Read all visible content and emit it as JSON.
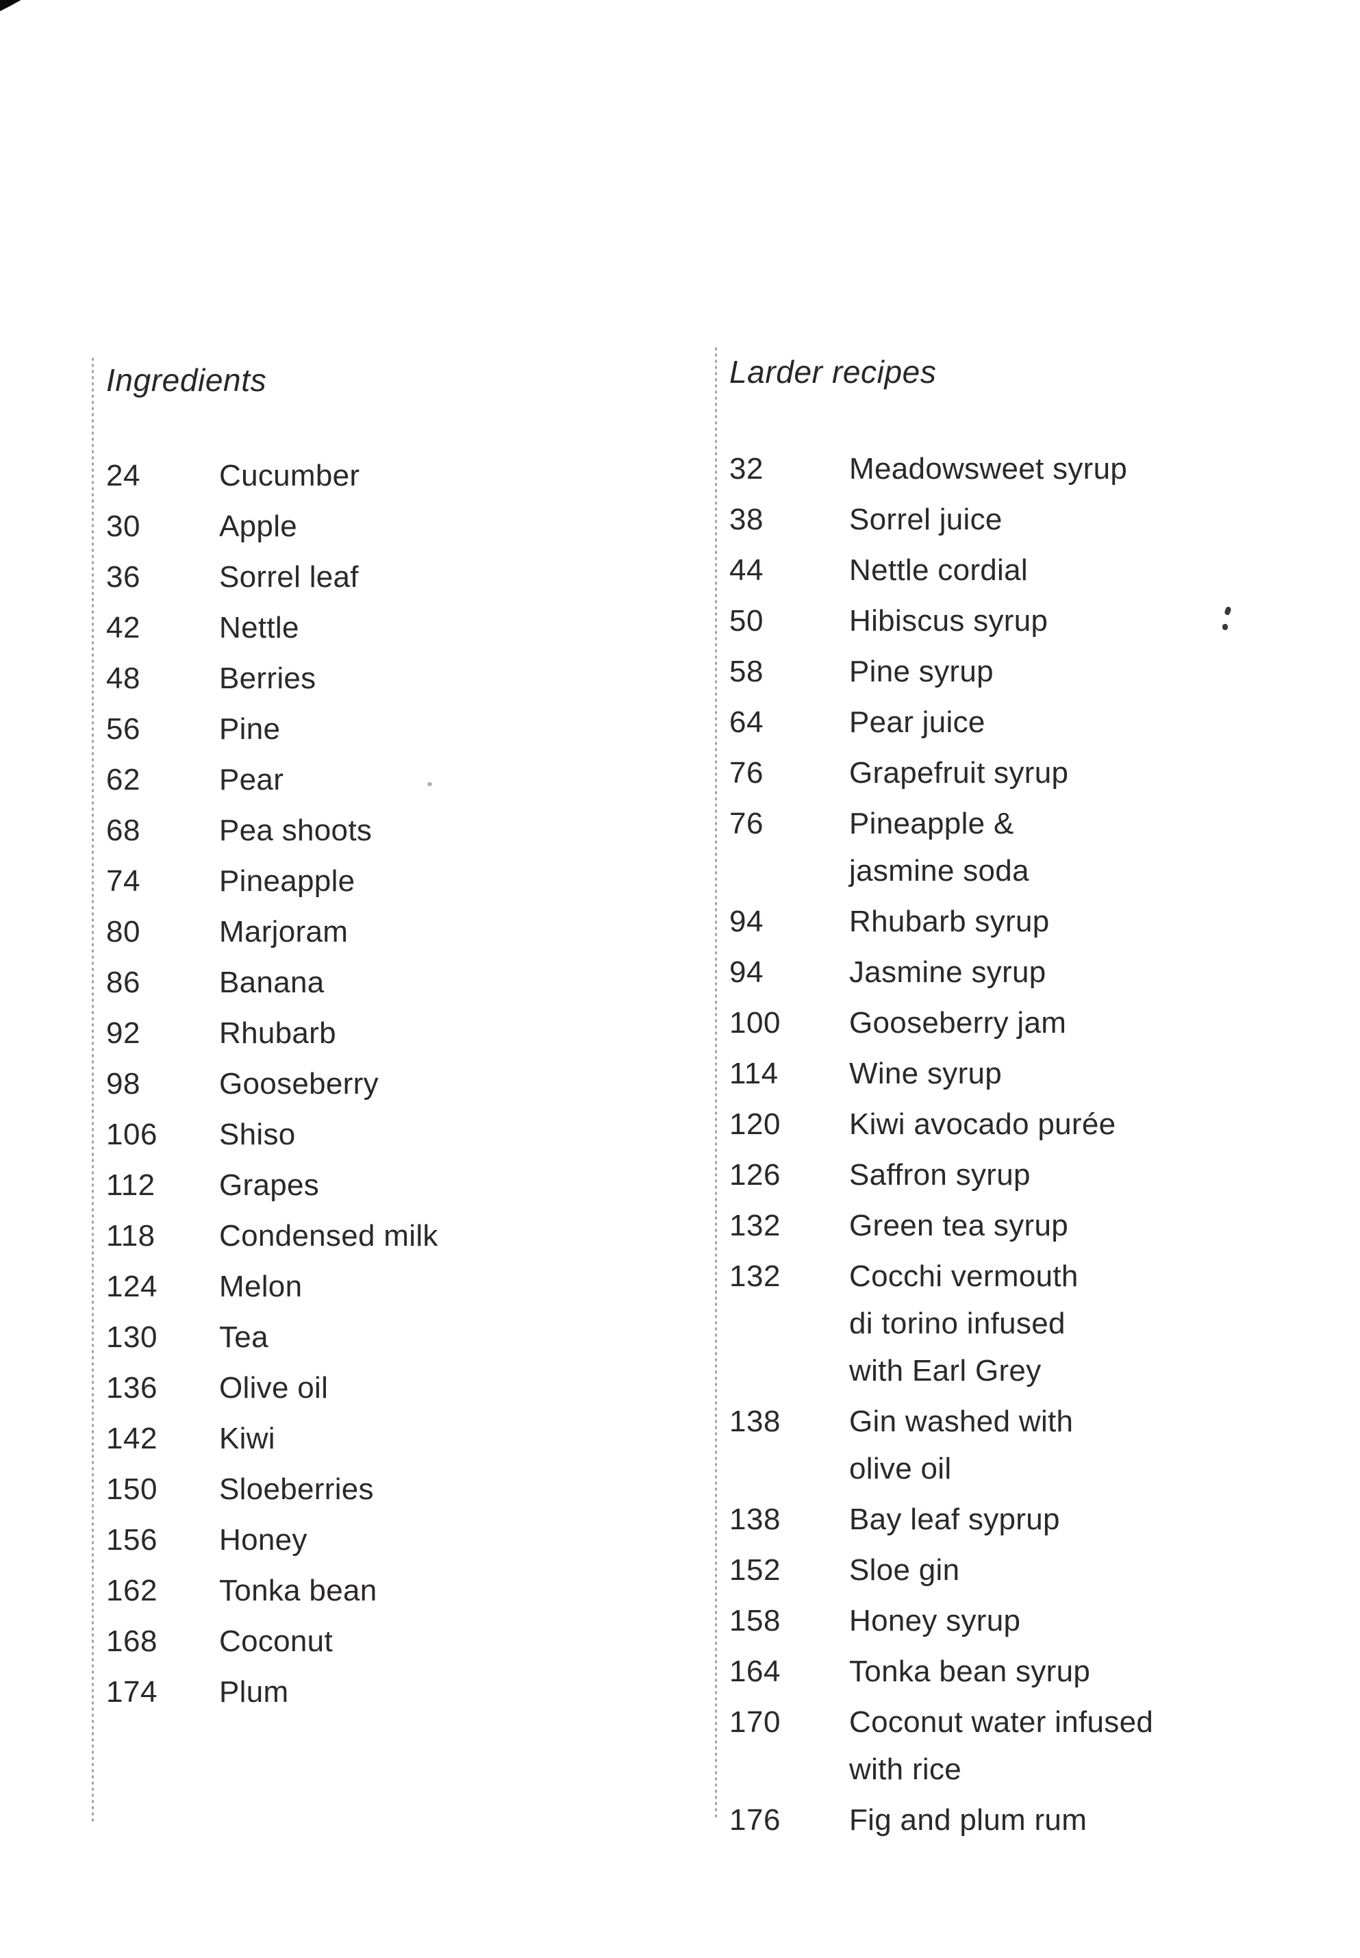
{
  "page": {
    "background_color": "#ffffff",
    "text_color": "#2c2829"
  },
  "columns": [
    {
      "id": "ingredients",
      "heading": "Ingredients",
      "entries": [
        {
          "page": "24",
          "lines": [
            "Cucumber"
          ]
        },
        {
          "page": "30",
          "lines": [
            "Apple"
          ]
        },
        {
          "page": "36",
          "lines": [
            "Sorrel leaf"
          ]
        },
        {
          "page": "42",
          "lines": [
            "Nettle"
          ]
        },
        {
          "page": "48",
          "lines": [
            "Berries"
          ]
        },
        {
          "page": "56",
          "lines": [
            "Pine"
          ]
        },
        {
          "page": "62",
          "lines": [
            "Pear"
          ]
        },
        {
          "page": "68",
          "lines": [
            "Pea shoots"
          ]
        },
        {
          "page": "74",
          "lines": [
            "Pineapple"
          ]
        },
        {
          "page": "80",
          "lines": [
            "Marjoram"
          ]
        },
        {
          "page": "86",
          "lines": [
            "Banana"
          ]
        },
        {
          "page": "92",
          "lines": [
            "Rhubarb"
          ]
        },
        {
          "page": "98",
          "lines": [
            "Gooseberry"
          ]
        },
        {
          "page": "106",
          "lines": [
            "Shiso"
          ]
        },
        {
          "page": "112",
          "lines": [
            "Grapes"
          ]
        },
        {
          "page": "118",
          "lines": [
            "Condensed milk"
          ]
        },
        {
          "page": "124",
          "lines": [
            "Melon"
          ]
        },
        {
          "page": "130",
          "lines": [
            "Tea"
          ]
        },
        {
          "page": "136",
          "lines": [
            "Olive oil"
          ]
        },
        {
          "page": "142",
          "lines": [
            "Kiwi"
          ]
        },
        {
          "page": "150",
          "lines": [
            "Sloeberries"
          ]
        },
        {
          "page": "156",
          "lines": [
            "Honey"
          ]
        },
        {
          "page": "162",
          "lines": [
            "Tonka bean"
          ]
        },
        {
          "page": "168",
          "lines": [
            "Coconut"
          ]
        },
        {
          "page": "174",
          "lines": [
            "Plum"
          ]
        }
      ]
    },
    {
      "id": "larder-recipes",
      "heading": "Larder recipes",
      "entries": [
        {
          "page": "32",
          "lines": [
            "Meadowsweet syrup"
          ]
        },
        {
          "page": "38",
          "lines": [
            "Sorrel juice"
          ]
        },
        {
          "page": "44",
          "lines": [
            "Nettle cordial"
          ]
        },
        {
          "page": "50",
          "lines": [
            "Hibiscus syrup"
          ]
        },
        {
          "page": "58",
          "lines": [
            "Pine syrup"
          ]
        },
        {
          "page": "64",
          "lines": [
            "Pear juice"
          ]
        },
        {
          "page": "76",
          "lines": [
            "Grapefruit syrup"
          ]
        },
        {
          "page": "76",
          "lines": [
            "Pineapple &",
            "jasmine soda"
          ]
        },
        {
          "page": "94",
          "lines": [
            "Rhubarb syrup"
          ]
        },
        {
          "page": "94",
          "lines": [
            "Jasmine syrup"
          ]
        },
        {
          "page": "100",
          "lines": [
            "Gooseberry jam"
          ]
        },
        {
          "page": "114",
          "lines": [
            "Wine syrup"
          ]
        },
        {
          "page": "120",
          "lines": [
            "Kiwi avocado purée"
          ]
        },
        {
          "page": "126",
          "lines": [
            "Saffron syrup"
          ]
        },
        {
          "page": "132",
          "lines": [
            "Green tea syrup"
          ]
        },
        {
          "page": "132",
          "lines": [
            "Cocchi vermouth",
            "di torino infused",
            "with Earl Grey"
          ]
        },
        {
          "page": "138",
          "lines": [
            "Gin washed with",
            "olive oil"
          ]
        },
        {
          "page": "138",
          "lines": [
            "Bay leaf syprup"
          ]
        },
        {
          "page": "152",
          "lines": [
            "Sloe gin"
          ]
        },
        {
          "page": "158",
          "lines": [
            "Honey syrup"
          ]
        },
        {
          "page": "164",
          "lines": [
            "Tonka bean syrup"
          ]
        },
        {
          "page": "170",
          "lines": [
            "Coconut water infused",
            "with rice"
          ]
        },
        {
          "page": "176",
          "lines": [
            "Fig and plum rum"
          ]
        }
      ]
    }
  ]
}
